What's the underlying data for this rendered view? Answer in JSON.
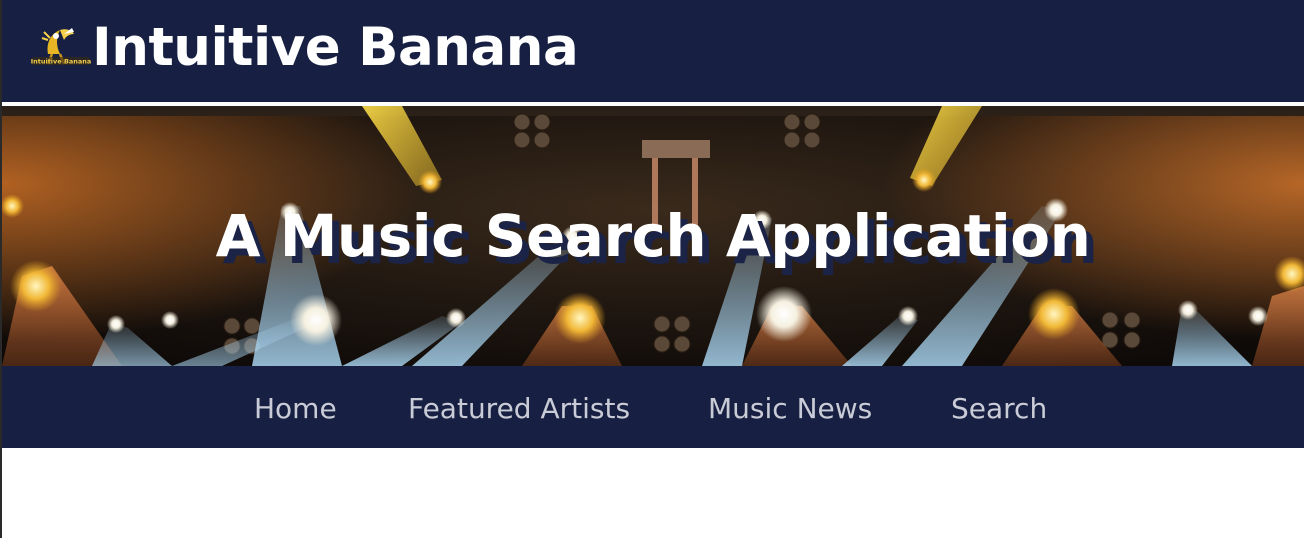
{
  "header": {
    "brand": "Intuitive Banana",
    "logo_icon": "banana-logo-icon",
    "logo_text": "Intuitive Banana",
    "background_color": "#172042"
  },
  "hero": {
    "title": "A Music Search Application",
    "image": "concert-stage-lights-image",
    "text_shadow_color": "#1b2346"
  },
  "nav": {
    "items": [
      {
        "label": "Home"
      },
      {
        "label": "Featured Artists"
      },
      {
        "label": "Music News"
      },
      {
        "label": "Search"
      }
    ],
    "background_color": "#172042",
    "text_color": "#c9ccd6"
  }
}
